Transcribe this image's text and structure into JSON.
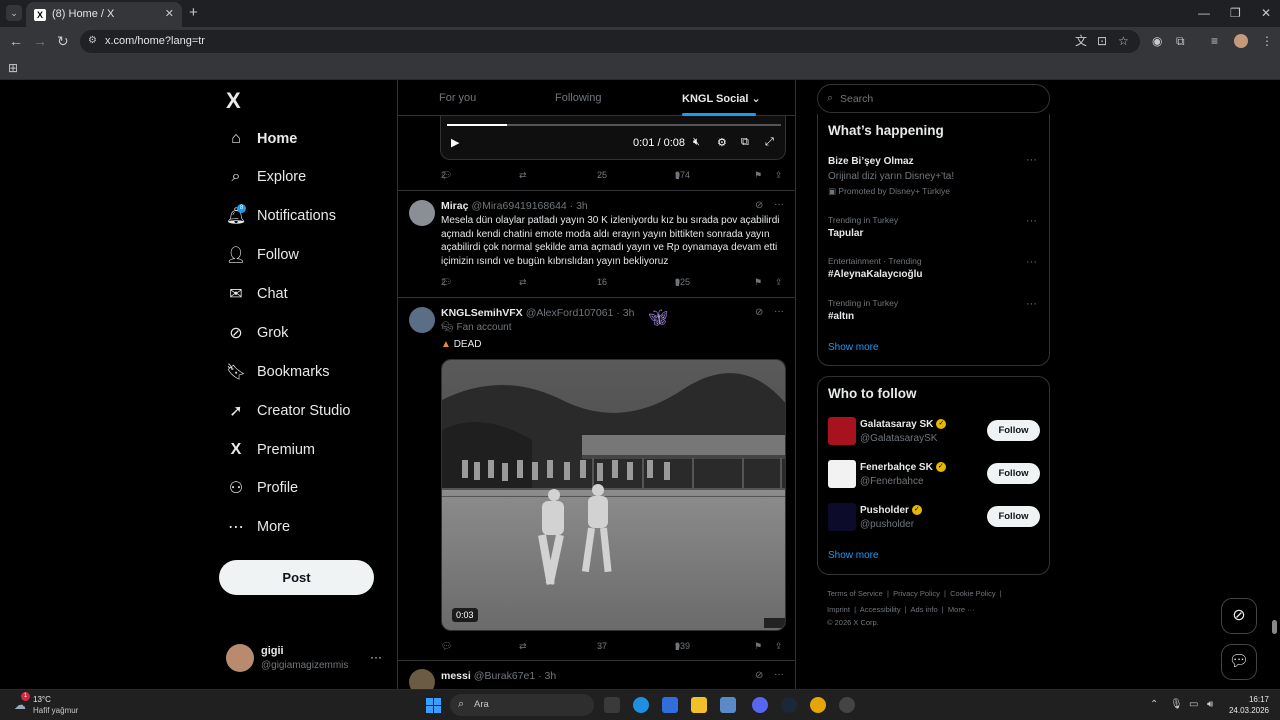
{
  "browser": {
    "tab_title": "(8) Home / X",
    "url": "x.com/home?lang=tr"
  },
  "nav": {
    "logo": "X",
    "items": [
      {
        "label": "Home"
      },
      {
        "label": "Explore"
      },
      {
        "label": "Notifications"
      },
      {
        "label": "Follow"
      },
      {
        "label": "Chat"
      },
      {
        "label": "Grok"
      },
      {
        "label": "Bookmarks"
      },
      {
        "label": "Creator Studio"
      },
      {
        "label": "Premium"
      },
      {
        "label": "Profile"
      },
      {
        "label": "More"
      }
    ],
    "notification_badge": "8",
    "post_button": "Post",
    "account": {
      "name": "gigii",
      "handle": "@gigiamagizemmis"
    }
  },
  "feed": {
    "tabs": [
      {
        "label": "For you"
      },
      {
        "label": "Following"
      },
      {
        "label": "KNGL Social"
      }
    ],
    "video": {
      "time": "0:01 / 0:08",
      "progress": 0.18
    },
    "post0_actions": {
      "replies": "2",
      "likes": "25",
      "views": "974"
    },
    "posts": [
      {
        "name": "Miraç",
        "handle": "@Mira69419168644 · 3h",
        "text": "Mesela dün olaylar patladı yayın 30 K izleniyordu kız bu sırada pov açabilirdi açmadı kendi chatini emote moda aldı erayın yayın bittikten sonrada yayın açabilirdi çok normal şekilde ama açmadı yayın ve Rp oynamaya devam etti içimizin ısındı ve bugün kıbrıslıdan yayın bekliyoruz",
        "replies": "2",
        "likes": "16",
        "views": "925"
      },
      {
        "name": "KNGLSemihVFX",
        "handle": "@AlexFord107061 · 3h",
        "badge": "Fan account",
        "text": "DEAD",
        "media_time": "0:03",
        "replies": "",
        "likes": "37",
        "views": "939"
      },
      {
        "name": "messi",
        "handle": "@Burak67e1 · 3h"
      }
    ]
  },
  "search": {
    "placeholder": "Search"
  },
  "happening": {
    "title": "What’s happening",
    "promo": {
      "title": "Bize Bi’şey Olmaz",
      "sub": "Orijinal dizi yarın Disney+'ta!",
      "promoted": "Promoted by Disney+ Türkiye"
    },
    "trends": [
      {
        "meta": "Trending in Turkey",
        "title": "Tapular"
      },
      {
        "meta": "Entertainment · Trending",
        "title": "#AleynaKalaycıoğlu"
      },
      {
        "meta": "Trending in Turkey",
        "title": "#altın"
      }
    ],
    "show_more": "Show more"
  },
  "who_to_follow": {
    "title": "Who to follow",
    "accounts": [
      {
        "name": "Galatasaray SK",
        "handle": "@GalatasaraySK",
        "button": "Follow"
      },
      {
        "name": "Fenerbahçe SK",
        "handle": "@Fenerbahce",
        "button": "Follow"
      },
      {
        "name": "Pusholder",
        "handle": "@pusholder",
        "button": "Follow"
      }
    ],
    "show_more": "Show more"
  },
  "footer": {
    "line1": [
      "Terms of Service",
      "Privacy Policy",
      "Cookie Policy"
    ],
    "line2": [
      "Imprint",
      "Accessibility",
      "Ads info",
      "More ···"
    ],
    "copyright": "© 2026 X Corp."
  },
  "taskbar": {
    "temp": "13°C",
    "weather": "Hafif yağmur",
    "weather_badge": "1",
    "search_label": "Ara",
    "time": "16:17",
    "date": "24.03.2026"
  },
  "colors": {
    "accent": "#1d9bf0",
    "background": "#000000",
    "border": "#2f3336"
  }
}
